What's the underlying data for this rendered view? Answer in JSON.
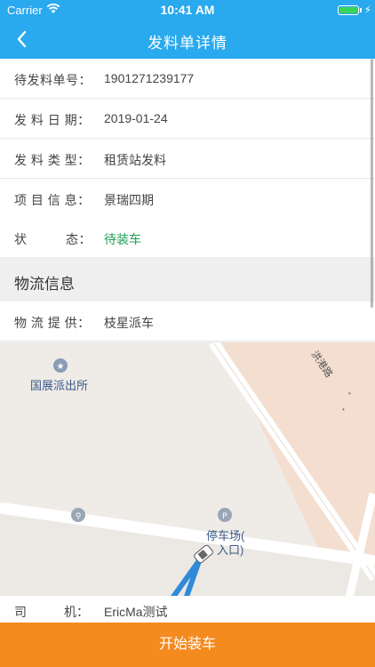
{
  "status": {
    "carrier": "Carrier",
    "time": "10:41 AM"
  },
  "nav": {
    "title": "发料单详情"
  },
  "rows": [
    {
      "label": "待发料单号：",
      "value": "1901271239177"
    },
    {
      "label": "发 料 日 期：",
      "value": "2019-01-24"
    },
    {
      "label": "发 料 类 型：",
      "value": "租赁站发料"
    },
    {
      "label": "项 目 信 息：",
      "value": "景瑞四期"
    },
    {
      "label": "状　　　态：",
      "value": "待装车"
    }
  ],
  "status_color": "#1fa055",
  "logistics": {
    "section_title": "物流信息",
    "provider_label": "物 流 提 供：",
    "provider_value": "枝星派车",
    "driver_label": "司　　　机：",
    "driver_value": "EricMa测试"
  },
  "map": {
    "poi_police": "国展派出所",
    "poi_parking_line1": "停车场(",
    "poi_parking_line2": "入口)",
    "road_name": "洪港路"
  },
  "action": {
    "label": "开始装车"
  },
  "colors": {
    "nav": "#29a9ee",
    "button": "#f58a1f"
  }
}
